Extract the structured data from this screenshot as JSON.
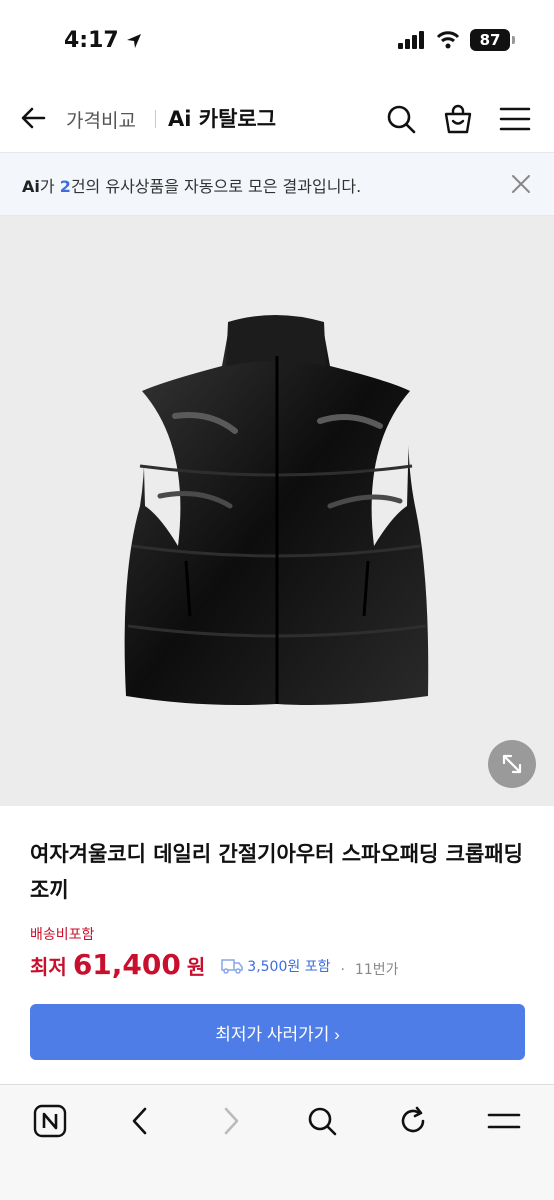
{
  "status_bar": {
    "time": "4:17",
    "battery": "87"
  },
  "header": {
    "breadcrumb": "가격비교",
    "title": "Ai 카탈로그"
  },
  "notice": {
    "prefix": "Ai",
    "text_before": "가 ",
    "count": "2",
    "text_after": "건의 유사상품을 자동으로 모은 결과입니다."
  },
  "product": {
    "title": "여자겨울코디 데일리 간절기아우터 스파오패딩 크롭패딩조끼",
    "shipping_label": "배송비포함",
    "price_prefix": "최저",
    "price_value": "61,400",
    "price_unit": "원",
    "shipping_fee": "3,500원 포함",
    "separator": "·",
    "sellers": "11번가"
  },
  "buy_button": {
    "label": "최저가 사러가기 ›"
  },
  "colors": {
    "accent": "#4f7de8",
    "price": "#c8102e",
    "link": "#3d6de0"
  },
  "icons": [
    "back-arrow-icon",
    "search-icon",
    "shopping-bag-icon",
    "menu-icon",
    "close-icon",
    "expand-icon",
    "naver-home-icon",
    "chevron-left-icon",
    "chevron-right-icon",
    "refresh-icon"
  ]
}
